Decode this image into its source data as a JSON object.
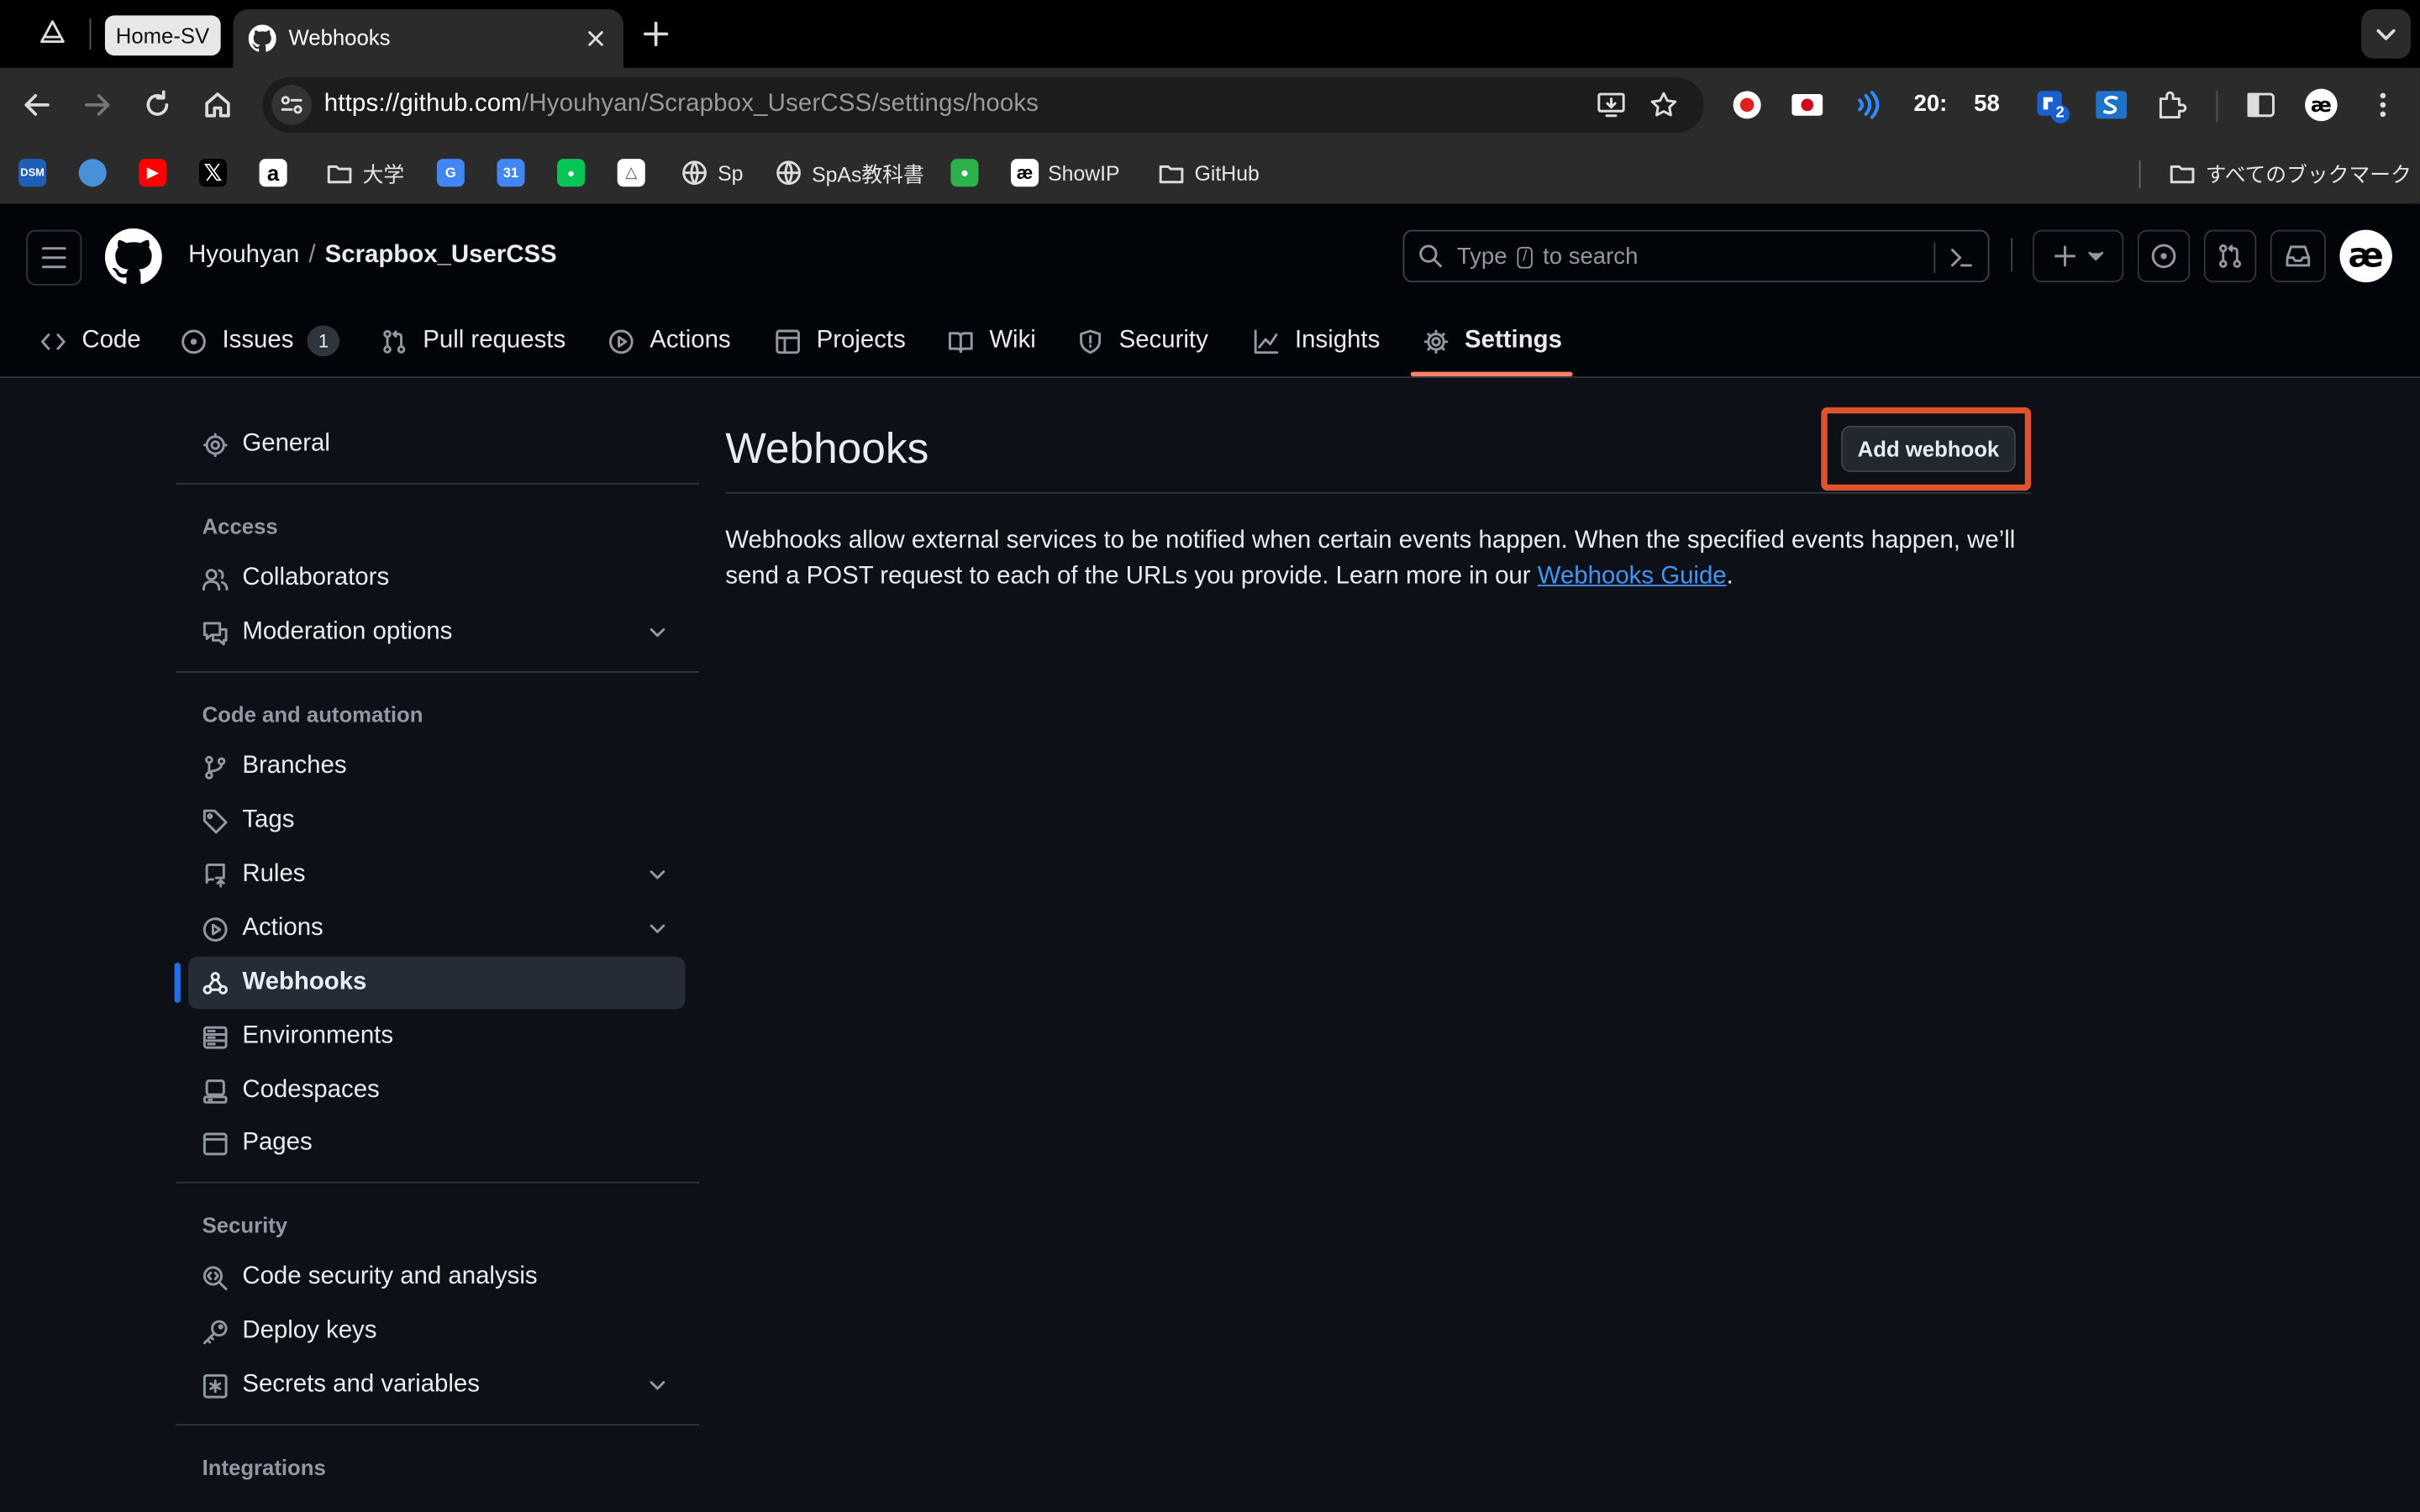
{
  "browser": {
    "tab_group_label": "Home-SV",
    "active_tab_title": "Webhooks",
    "url_host": "https://github.com",
    "url_path": "/Hyouhyan/Scrapbox_UserCSS/settings/hooks",
    "extensions": {
      "time_hour": "20:",
      "time_min": "58",
      "badge": "2"
    },
    "bookmarks": [
      "大学",
      "Sp",
      "SpAs教科書",
      "ShowIP",
      "GitHub"
    ],
    "all_bookmarks": "すべてのブックマーク"
  },
  "header": {
    "owner": "Hyouhyan",
    "separator": "/",
    "repo": "Scrapbox_UserCSS",
    "search_prefix": "Type",
    "search_key": "/",
    "search_suffix": "to search"
  },
  "repo_nav": {
    "code": "Code",
    "issues": "Issues",
    "issues_count": "1",
    "pull_requests": "Pull requests",
    "actions": "Actions",
    "projects": "Projects",
    "wiki": "Wiki",
    "security": "Security",
    "insights": "Insights",
    "settings": "Settings"
  },
  "sidebar": {
    "general": "General",
    "access_heading": "Access",
    "collaborators": "Collaborators",
    "moderation": "Moderation options",
    "code_heading": "Code and automation",
    "branches": "Branches",
    "tags": "Tags",
    "rules": "Rules",
    "actions": "Actions",
    "webhooks": "Webhooks",
    "environments": "Environments",
    "codespaces": "Codespaces",
    "pages": "Pages",
    "security_heading": "Security",
    "code_security": "Code security and analysis",
    "deploy_keys": "Deploy keys",
    "secrets": "Secrets and variables",
    "integrations_heading": "Integrations"
  },
  "main": {
    "title": "Webhooks",
    "add_button": "Add webhook",
    "desc_before": "Webhooks allow external services to be notified when certain events happen. When the specified events happen, we’ll send a POST request to each of the URLs you provide. Learn more in our ",
    "desc_link": "Webhooks Guide",
    "desc_after": "."
  },
  "colors": {
    "accent_underline": "#f78166",
    "selection_bar": "#1f6feb",
    "link": "#4493f8",
    "highlight_box": "#e0532f"
  }
}
